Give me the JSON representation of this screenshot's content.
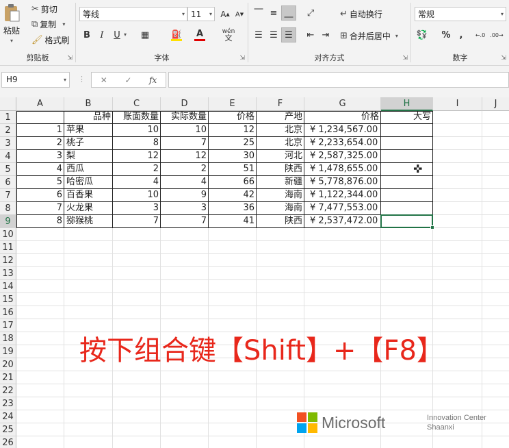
{
  "ribbon": {
    "clipboard": {
      "paste": "粘贴",
      "cut": "剪切",
      "copy": "复制",
      "format_painter": "格式刷",
      "label": "剪贴板"
    },
    "font": {
      "name": "等线",
      "size": "11",
      "label": "字体",
      "bold": "B",
      "italic": "I",
      "underline": "U",
      "phonetic": "wén"
    },
    "alignment": {
      "wrap_text": "自动换行",
      "merge_center": "合并后居中",
      "label": "对齐方式"
    },
    "number": {
      "format": "常规",
      "percent": "%",
      "comma": ",",
      "label": "数字"
    }
  },
  "formula_bar": {
    "name_box": "H9",
    "fx": "fx",
    "value": ""
  },
  "columns": [
    "A",
    "B",
    "C",
    "D",
    "E",
    "F",
    "G",
    "H",
    "I",
    "J"
  ],
  "rows": [
    "1",
    "2",
    "3",
    "4",
    "5",
    "6",
    "7",
    "8",
    "9",
    "10",
    "11",
    "12",
    "13",
    "14",
    "15",
    "16",
    "17",
    "18",
    "19",
    "20",
    "21",
    "22",
    "23",
    "24",
    "25",
    "26"
  ],
  "table": {
    "headers": [
      "",
      "品种",
      "账面数量",
      "实际数量",
      "价格",
      "产地",
      "价格",
      "大写"
    ],
    "data": [
      [
        "1",
        "苹果",
        "10",
        "10",
        "12",
        "北京",
        "¥  1,234,567.00",
        ""
      ],
      [
        "2",
        "桃子",
        "8",
        "7",
        "25",
        "北京",
        "¥  2,233,654.00",
        ""
      ],
      [
        "3",
        "梨",
        "12",
        "12",
        "30",
        "河北",
        "¥  2,587,325.00",
        ""
      ],
      [
        "4",
        "西瓜",
        "2",
        "2",
        "51",
        "陕西",
        "¥  1,478,655.00",
        ""
      ],
      [
        "5",
        "哈密瓜",
        "4",
        "4",
        "66",
        "新疆",
        "¥  5,778,876.00",
        ""
      ],
      [
        "6",
        "百香果",
        "10",
        "9",
        "42",
        "海南",
        "¥  1,122,344.00",
        ""
      ],
      [
        "7",
        "火龙果",
        "3",
        "3",
        "36",
        "海南",
        "¥  7,477,553.00",
        ""
      ],
      [
        "8",
        "猕猴桃",
        "7",
        "7",
        "41",
        "陕西",
        "¥  2,537,472.00",
        ""
      ]
    ]
  },
  "selected_cell": "H9",
  "overlay_text": "按下组合键【Shift】+【F8】",
  "watermark": {
    "brand": "Microsoft",
    "line1": "Innovation Center",
    "line2": "Shaanxi"
  },
  "colors": {
    "accent": "#217346",
    "overlay": "#e8271b"
  }
}
